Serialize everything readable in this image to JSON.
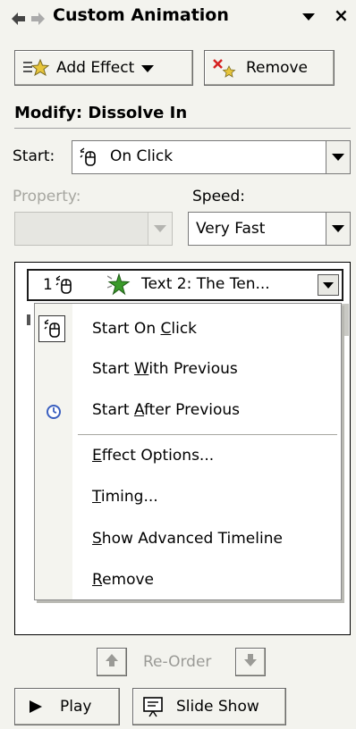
{
  "panel": {
    "title": "Custom Animation"
  },
  "toolbar": {
    "add_effect": "Add Effect",
    "remove": "Remove"
  },
  "modify": {
    "heading": "Modify: Dissolve In"
  },
  "start": {
    "label": "Start:",
    "value": "On Click"
  },
  "property": {
    "label": "Property:",
    "value": ""
  },
  "speed": {
    "label": "Speed:",
    "value": "Very Fast"
  },
  "list": {
    "item_number": "1",
    "item_label": "Text 2: The Ten...",
    "menu": [
      {
        "pre": "Start On ",
        "u": "C",
        "post": "lick",
        "icon": "mouse-icon",
        "checked": true
      },
      {
        "pre": "Start ",
        "u": "W",
        "post": "ith Previous",
        "icon": "",
        "checked": false
      },
      {
        "pre": "Start ",
        "u": "A",
        "post": "fter Previous",
        "icon": "clock-icon",
        "checked": false
      },
      {
        "pre": "",
        "u": "E",
        "post": "ffect Options...",
        "icon": "",
        "checked": false
      },
      {
        "pre": "",
        "u": "T",
        "post": "iming...",
        "icon": "",
        "checked": false
      },
      {
        "pre": "",
        "u": "S",
        "post": "how Advanced Timeline",
        "icon": "",
        "checked": false
      },
      {
        "pre": "",
        "u": "R",
        "post": "emove",
        "icon": "",
        "checked": false
      }
    ]
  },
  "reorder": {
    "label": "Re-Order"
  },
  "bottom": {
    "play": "Play",
    "slideshow": "Slide Show"
  },
  "colors": {
    "panel_bg": "#f3f3ee",
    "star_green": "#3a9a2a",
    "clock_blue": "#3a5fbf"
  }
}
